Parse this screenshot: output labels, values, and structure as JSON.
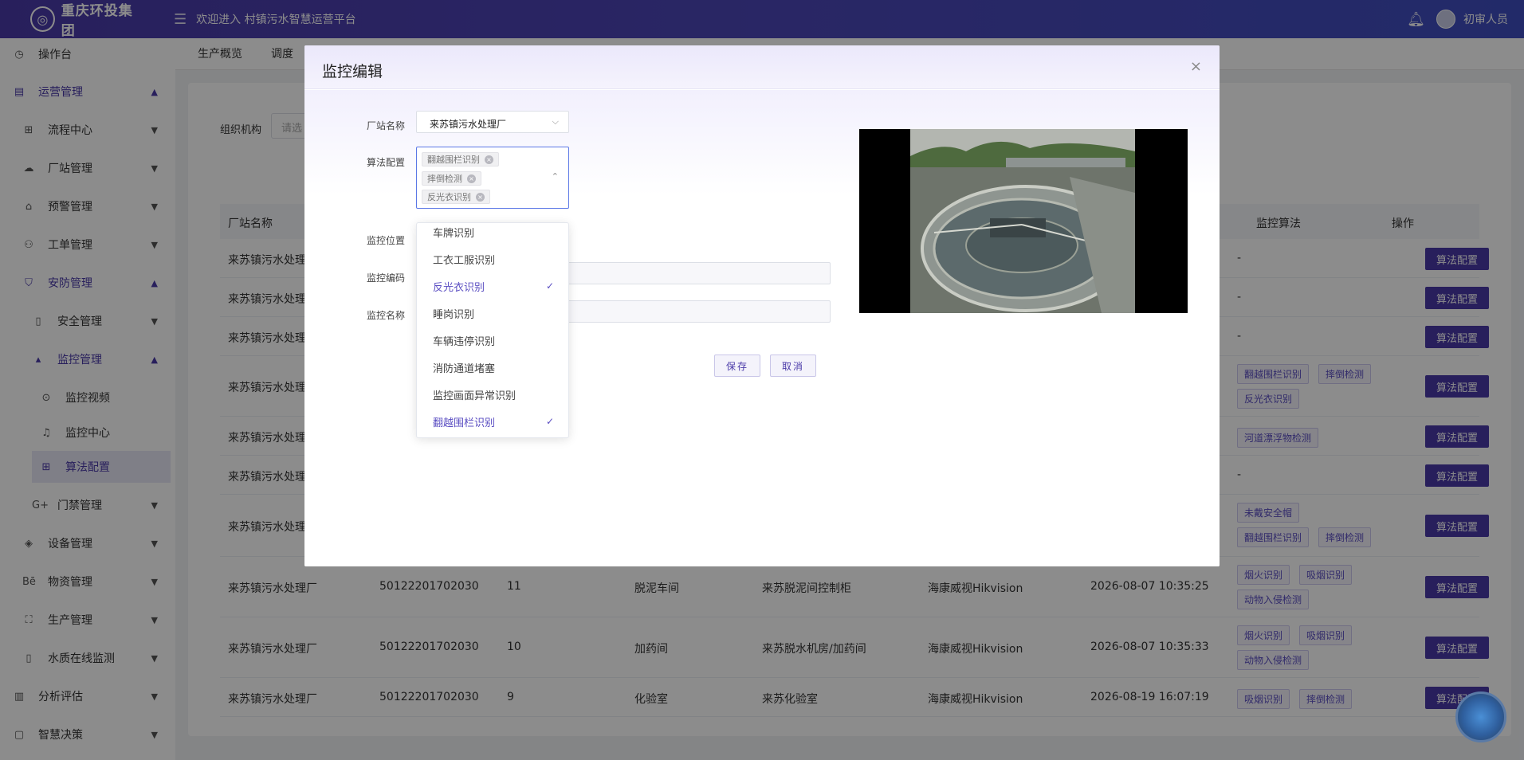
{
  "header": {
    "logo_text": "重庆环投集团",
    "welcome": "欢迎进入 村镇污水智慧运营平台",
    "username": "初审人员"
  },
  "sidebar": {
    "items": [
      {
        "label": "操作台",
        "icon": "dashboard-icon"
      },
      {
        "label": "运营管理",
        "icon": "operations-icon"
      },
      {
        "label": "流程中心",
        "icon": "flow-icon"
      },
      {
        "label": "厂站管理",
        "icon": "cloud-icon"
      },
      {
        "label": "预警管理",
        "icon": "home-icon"
      },
      {
        "label": "工单管理",
        "icon": "org-icon"
      },
      {
        "label": "安防管理",
        "icon": "shield-icon"
      },
      {
        "label": "安全管理",
        "icon": "document-icon"
      },
      {
        "label": "监控管理",
        "icon": "triangle-icon"
      },
      {
        "label": "监控视频",
        "icon": "play-icon"
      },
      {
        "label": "监控中心",
        "icon": "bell-icon"
      },
      {
        "label": "算法配置",
        "icon": "grid-icon"
      },
      {
        "label": "门禁管理",
        "icon": "gplus-icon"
      },
      {
        "label": "设备管理",
        "icon": "target-icon"
      },
      {
        "label": "物资管理",
        "icon": "behance-icon"
      },
      {
        "label": "生产管理",
        "icon": "scan-icon"
      },
      {
        "label": "水质在线监测",
        "icon": "file-icon"
      },
      {
        "label": "分析评估",
        "icon": "bars-icon"
      },
      {
        "label": "智慧决策",
        "icon": "square-icon"
      }
    ]
  },
  "tabs": [
    "生产概览",
    "调度"
  ],
  "filter": {
    "label": "组织机构",
    "placeholder": "请选"
  },
  "table": {
    "headers": {
      "station": "厂站名称",
      "algorithm": "监控算法",
      "operation": "操作"
    },
    "op_label": "算法配置",
    "rows": [
      {
        "station": "来苏镇污水处理",
        "code": "",
        "no": "",
        "location": "",
        "name": "",
        "brand": "",
        "time": "",
        "algos": []
      },
      {
        "station": "来苏镇污水处理",
        "code": "",
        "no": "",
        "location": "",
        "name": "",
        "brand": "",
        "time": "",
        "algos": []
      },
      {
        "station": "来苏镇污水处理",
        "code": "",
        "no": "",
        "location": "",
        "name": "",
        "brand": "",
        "time": "",
        "algos": []
      },
      {
        "station": "来苏镇污水处理",
        "code": "",
        "no": "",
        "location": "",
        "name": "",
        "brand": "",
        "time": "",
        "algos": [
          "翻越围栏识别",
          "摔倒检测",
          "反光衣识别"
        ]
      },
      {
        "station": "来苏镇污水处理",
        "code": "",
        "no": "",
        "location": "",
        "name": "",
        "brand": "",
        "time": "",
        "algos": [
          "河道漂浮物检测"
        ]
      },
      {
        "station": "来苏镇污水处理",
        "code": "",
        "no": "",
        "location": "",
        "name": "",
        "brand": "",
        "time": "",
        "algos": []
      },
      {
        "station": "来苏镇污水处理",
        "code": "",
        "no": "",
        "location": "",
        "name": "",
        "brand": "",
        "time": "",
        "algos": [
          "未戴安全帽",
          "翻越围栏识别",
          "摔倒检测"
        ]
      },
      {
        "station": "来苏镇污水处理厂",
        "code": "50122201702030",
        "no": "11",
        "location": "脱泥车间",
        "name": "来苏脱泥间控制柜",
        "brand": "海康威视Hikvision",
        "time": "2026-08-07 10:35:25",
        "algos": [
          "烟火识别",
          "吸烟识别",
          "动物入侵检测"
        ]
      },
      {
        "station": "来苏镇污水处理厂",
        "code": "50122201702030",
        "no": "10",
        "location": "加药间",
        "name": "来苏脱水机房/加药间",
        "brand": "海康威视Hikvision",
        "time": "2026-08-07 10:35:33",
        "algos": [
          "烟火识别",
          "吸烟识别",
          "动物入侵检测"
        ]
      },
      {
        "station": "来苏镇污水处理厂",
        "code": "50122201702030",
        "no": "9",
        "location": "化验室",
        "name": "来苏化验室",
        "brand": "海康威视Hikvision",
        "time": "2026-08-19 16:07:19",
        "algos": [
          "吸烟识别",
          "摔倒检测"
        ]
      }
    ],
    "dash": "-"
  },
  "dialog": {
    "title": "监控编辑",
    "close": "×",
    "fields": {
      "station_label": "厂站名称",
      "station_value": "来苏镇污水处理厂",
      "algo_label": "算法配置",
      "algo_tags": [
        "翻越围栏识别",
        "摔倒检测",
        "反光衣识别"
      ],
      "location_label": "监控位置",
      "code_label": "监控编码",
      "name_label": "监控名称"
    },
    "save": "保存",
    "cancel": "取消",
    "dropdown": [
      {
        "label": "车牌识别",
        "selected": false
      },
      {
        "label": "工衣工服识别",
        "selected": false
      },
      {
        "label": "反光衣识别",
        "selected": true
      },
      {
        "label": "睡岗识别",
        "selected": false
      },
      {
        "label": "车辆违停识别",
        "selected": false
      },
      {
        "label": "消防通道堵塞",
        "selected": false
      },
      {
        "label": "监控画面异常识别",
        "selected": false
      },
      {
        "label": "翻越围栏识别",
        "selected": true
      }
    ]
  },
  "colors": {
    "primary": "#4a3aa8",
    "tag_text": "#5a4dc2"
  }
}
